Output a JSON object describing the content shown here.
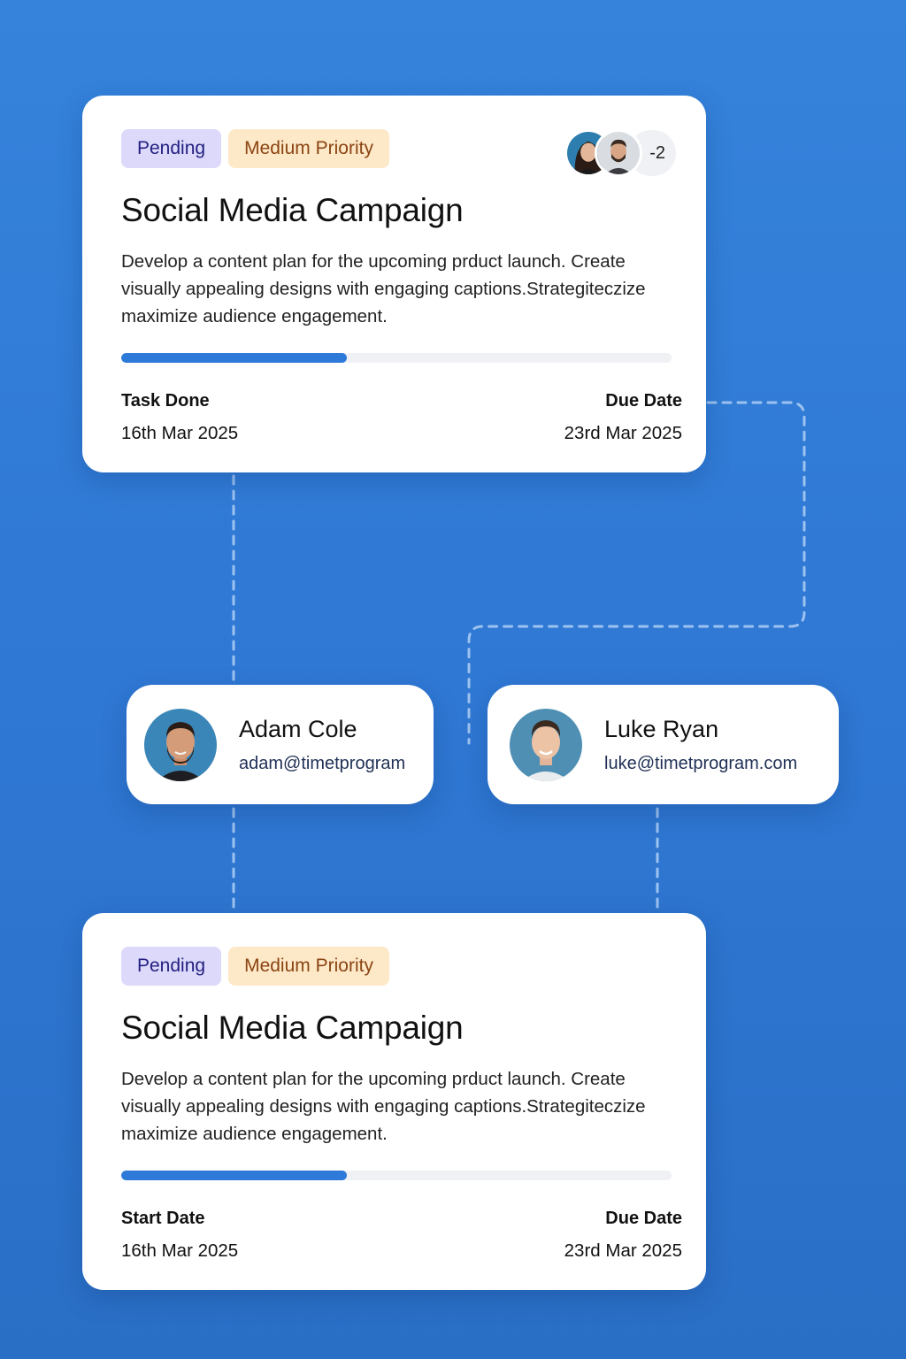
{
  "colors": {
    "background": "#3583db",
    "accent": "#2e7ad9",
    "pending_bg": "#dcd9fb",
    "pending_text": "#221f80",
    "priority_bg": "#fde8c8",
    "priority_text": "#8b4513"
  },
  "tasks": [
    {
      "status": "Pending",
      "priority": "Medium Priority",
      "title": "Social Media Campaign",
      "description": "Develop a content plan for the upcoming prduct launch. Create visually appealing designs with engaging captions.Strategiteczize maximize audience engagement.",
      "progress": 0.41,
      "assignees_more": "-2",
      "left_label": "Task Done",
      "left_value": "16th Mar 2025",
      "right_label": "Due Date",
      "right_value": "23rd Mar 2025"
    },
    {
      "status": "Pending",
      "priority": "Medium Priority",
      "title": "Social Media Campaign",
      "description": "Develop a content plan for the upcoming prduct launch. Create visually appealing designs with engaging captions.Strategiteczize maximize audience engagement.",
      "progress": 0.41,
      "left_label": "Start Date",
      "left_value": "16th Mar 2025",
      "right_label": "Due Date",
      "right_value": "23rd Mar 2025"
    }
  ],
  "people": [
    {
      "name": "Adam Cole",
      "email": "adam@timetprogram",
      "avatar": "man-beard-avatar"
    },
    {
      "name": "Luke Ryan",
      "email": "luke@timetprogram.com",
      "avatar": "young-man-avatar"
    }
  ]
}
